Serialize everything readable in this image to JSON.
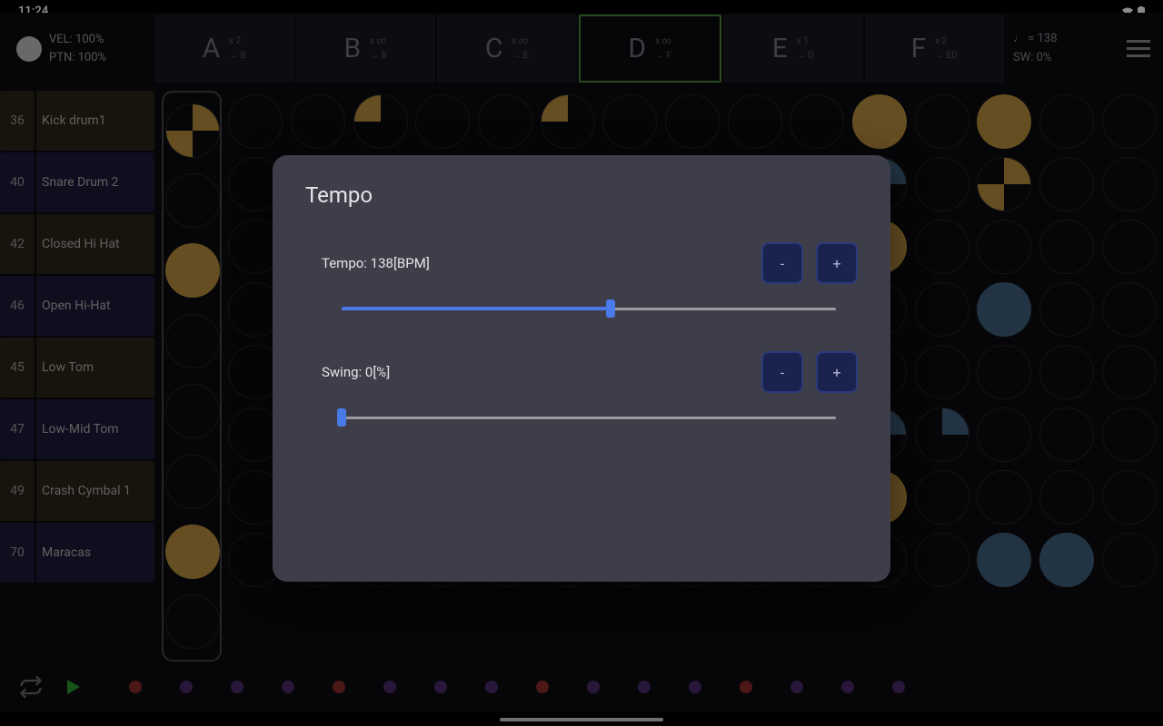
{
  "status": {
    "time": "11:24"
  },
  "header": {
    "vel": "VEL: 100%",
    "ptn": "PTN: 100%",
    "tempo_line": "♩ = 138",
    "swing_line": "SW: 0%"
  },
  "patterns": [
    {
      "letter": "A",
      "repeat": "x 2",
      "next": "→ B",
      "active": false
    },
    {
      "letter": "B",
      "repeat": "x ∞",
      "next": "→ B",
      "active": false
    },
    {
      "letter": "C",
      "repeat": "x ∞",
      "next": "→ E",
      "active": false
    },
    {
      "letter": "D",
      "repeat": "x ∞",
      "next": "→ F",
      "active": true
    },
    {
      "letter": "E",
      "repeat": "x 1",
      "next": "→ D",
      "active": false
    },
    {
      "letter": "F",
      "repeat": "x 2",
      "next": "→ ED",
      "active": false
    }
  ],
  "tracks": [
    {
      "num": "36",
      "name": "Kick drum1",
      "color": "gold"
    },
    {
      "num": "40",
      "name": "Snare Drum 2",
      "color": "blue"
    },
    {
      "num": "42",
      "name": "Closed Hi Hat",
      "color": "gold"
    },
    {
      "num": "46",
      "name": "Open Hi-Hat",
      "color": "blue"
    },
    {
      "num": "45",
      "name": "Low Tom",
      "color": "gold"
    },
    {
      "num": "47",
      "name": "Low-Mid Tom",
      "color": "blue"
    },
    {
      "num": "49",
      "name": "Crash Cymbal 1",
      "color": "gold"
    },
    {
      "num": "70",
      "name": "Maracas",
      "color": "blue"
    }
  ],
  "modal": {
    "title": "Tempo",
    "tempo_label": "Tempo: 138[BPM]",
    "tempo_value": 138,
    "tempo_min": 40,
    "tempo_max": 220,
    "swing_label": "Swing: 0[%]",
    "swing_value": 0,
    "minus": "-",
    "plus": "+"
  },
  "beat_colors": [
    "red",
    "purple",
    "purple",
    "purple",
    "red",
    "purple",
    "purple",
    "purple",
    "red",
    "purple",
    "purple",
    "purple",
    "red",
    "purple",
    "purple",
    "purple"
  ]
}
